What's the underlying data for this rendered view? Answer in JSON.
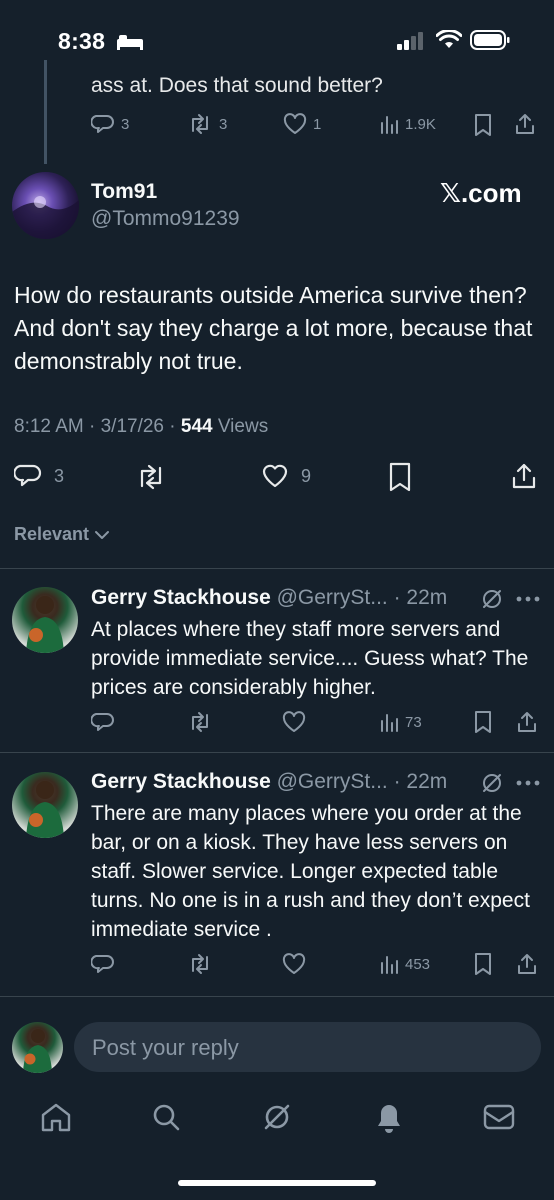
{
  "status_bar": {
    "time": "8:38"
  },
  "previous_tweet": {
    "text_tail": "ass at. Does that sound better?",
    "replies": "3",
    "reposts": "3",
    "likes": "1",
    "views": "1.9K"
  },
  "main_tweet": {
    "author_name": "Tom91",
    "author_handle": "@Tommo91239",
    "brand_label": "𝕏.com",
    "text": "How do restaurants outside America survive then? And don't say they charge a lot more, because that demonstrably not true.",
    "time_date": "8:12 AM · 3/17/26 · ",
    "views_count": "544",
    "views_label": " Views",
    "replies": "3",
    "likes": "9"
  },
  "sort_label": "Relevant",
  "replies": [
    {
      "name": "Gerry Stackhouse",
      "handle_time": " @GerrySt... · 22m",
      "text": "At places where they staff more servers and provide immediate service.... Guess what? The prices are considerably higher.",
      "views": "73"
    },
    {
      "name": "Gerry Stackhouse",
      "handle_time": " @GerrySt... · 22m",
      "text": "There are many places where you order at the bar, or on a kiosk. They have less servers on staff. Slower service. Longer expected table turns. No one is in a rush and they don’t expect immediate service .",
      "views": "453"
    }
  ],
  "composer": {
    "placeholder": "Post your reply"
  },
  "nav": [
    "home-icon",
    "search-icon",
    "grok-icon",
    "notifications-icon",
    "messages-icon"
  ],
  "colors": {
    "background": "#15202b",
    "muted": "#8b98a5",
    "text": "#f7f9f9",
    "composer": "#273340"
  }
}
